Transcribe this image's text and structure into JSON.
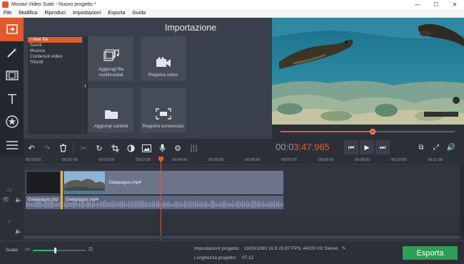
{
  "window": {
    "title": "Movavi Video Suite - Nuovo progetto *",
    "controls": [
      "—",
      "☐",
      "✕"
    ]
  },
  "menu": [
    "File",
    "Modifica",
    "Riproduci",
    "Impostazioni",
    "Esporta",
    "Guida"
  ],
  "import": {
    "title": "Importazione",
    "categories": [
      "I miei file",
      "Suoni",
      "Musica",
      "Contenuti video",
      "Sfondi"
    ],
    "selected_category": "I miei file",
    "tiles": {
      "add_files": "Aggiungi file multimediali",
      "record_video": "Registra video",
      "add_folder": "Aggiungi cartella",
      "record_screencast": "Registra screencast"
    }
  },
  "player": {
    "timecode_dim": "00:0",
    "timecode_live": "3:47.965",
    "progress": 0.53
  },
  "timeline": {
    "ticks": [
      "00:00:00",
      "00:01:00",
      "00:02:00",
      "00:03:00",
      "00:04:00",
      "00:05:00",
      "00:06:00",
      "00:07:00",
      "00:08:00",
      "00:09:00",
      "00:10:00",
      "00:11:00"
    ],
    "clips": {
      "video_label": "Galapagos.mp4",
      "audio_label_1": "Galapagos.mp",
      "audio_label_2": "Galapagos.mp4"
    }
  },
  "bottom": {
    "scale_label": "Scala:",
    "scale_value": 0.42,
    "settings_label": "Impostazioni progetto:",
    "settings_value": "1920x1080 16:9 29.97 FPS, 44100 Hz Stereo",
    "length_label": "Lunghezza progetto:",
    "length_value": "07:12",
    "export_label": "Esporta"
  },
  "colors": {
    "accent": "#e05a2b",
    "export": "#2f9e57",
    "panel": "#3a404b",
    "background": "#2b3038"
  }
}
